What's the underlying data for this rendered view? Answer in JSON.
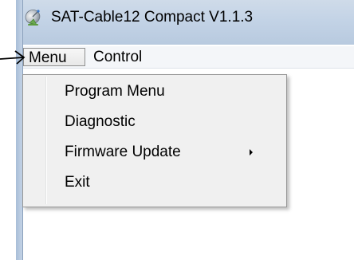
{
  "window": {
    "title": "SAT-Cable12 Compact V1.1.3",
    "app_icon": "satellite-dish-icon"
  },
  "menubar": {
    "items": [
      {
        "label": "Menu",
        "active": true
      },
      {
        "label": "Control",
        "active": false
      }
    ]
  },
  "dropdown": {
    "items": [
      {
        "label": "Program Menu",
        "has_submenu": false
      },
      {
        "label": "Diagnostic",
        "has_submenu": false
      },
      {
        "label": "Firmware Update",
        "has_submenu": true
      },
      {
        "label": "Exit",
        "has_submenu": false
      }
    ]
  },
  "annotation": {
    "icon": "pointer-arrow-icon"
  }
}
